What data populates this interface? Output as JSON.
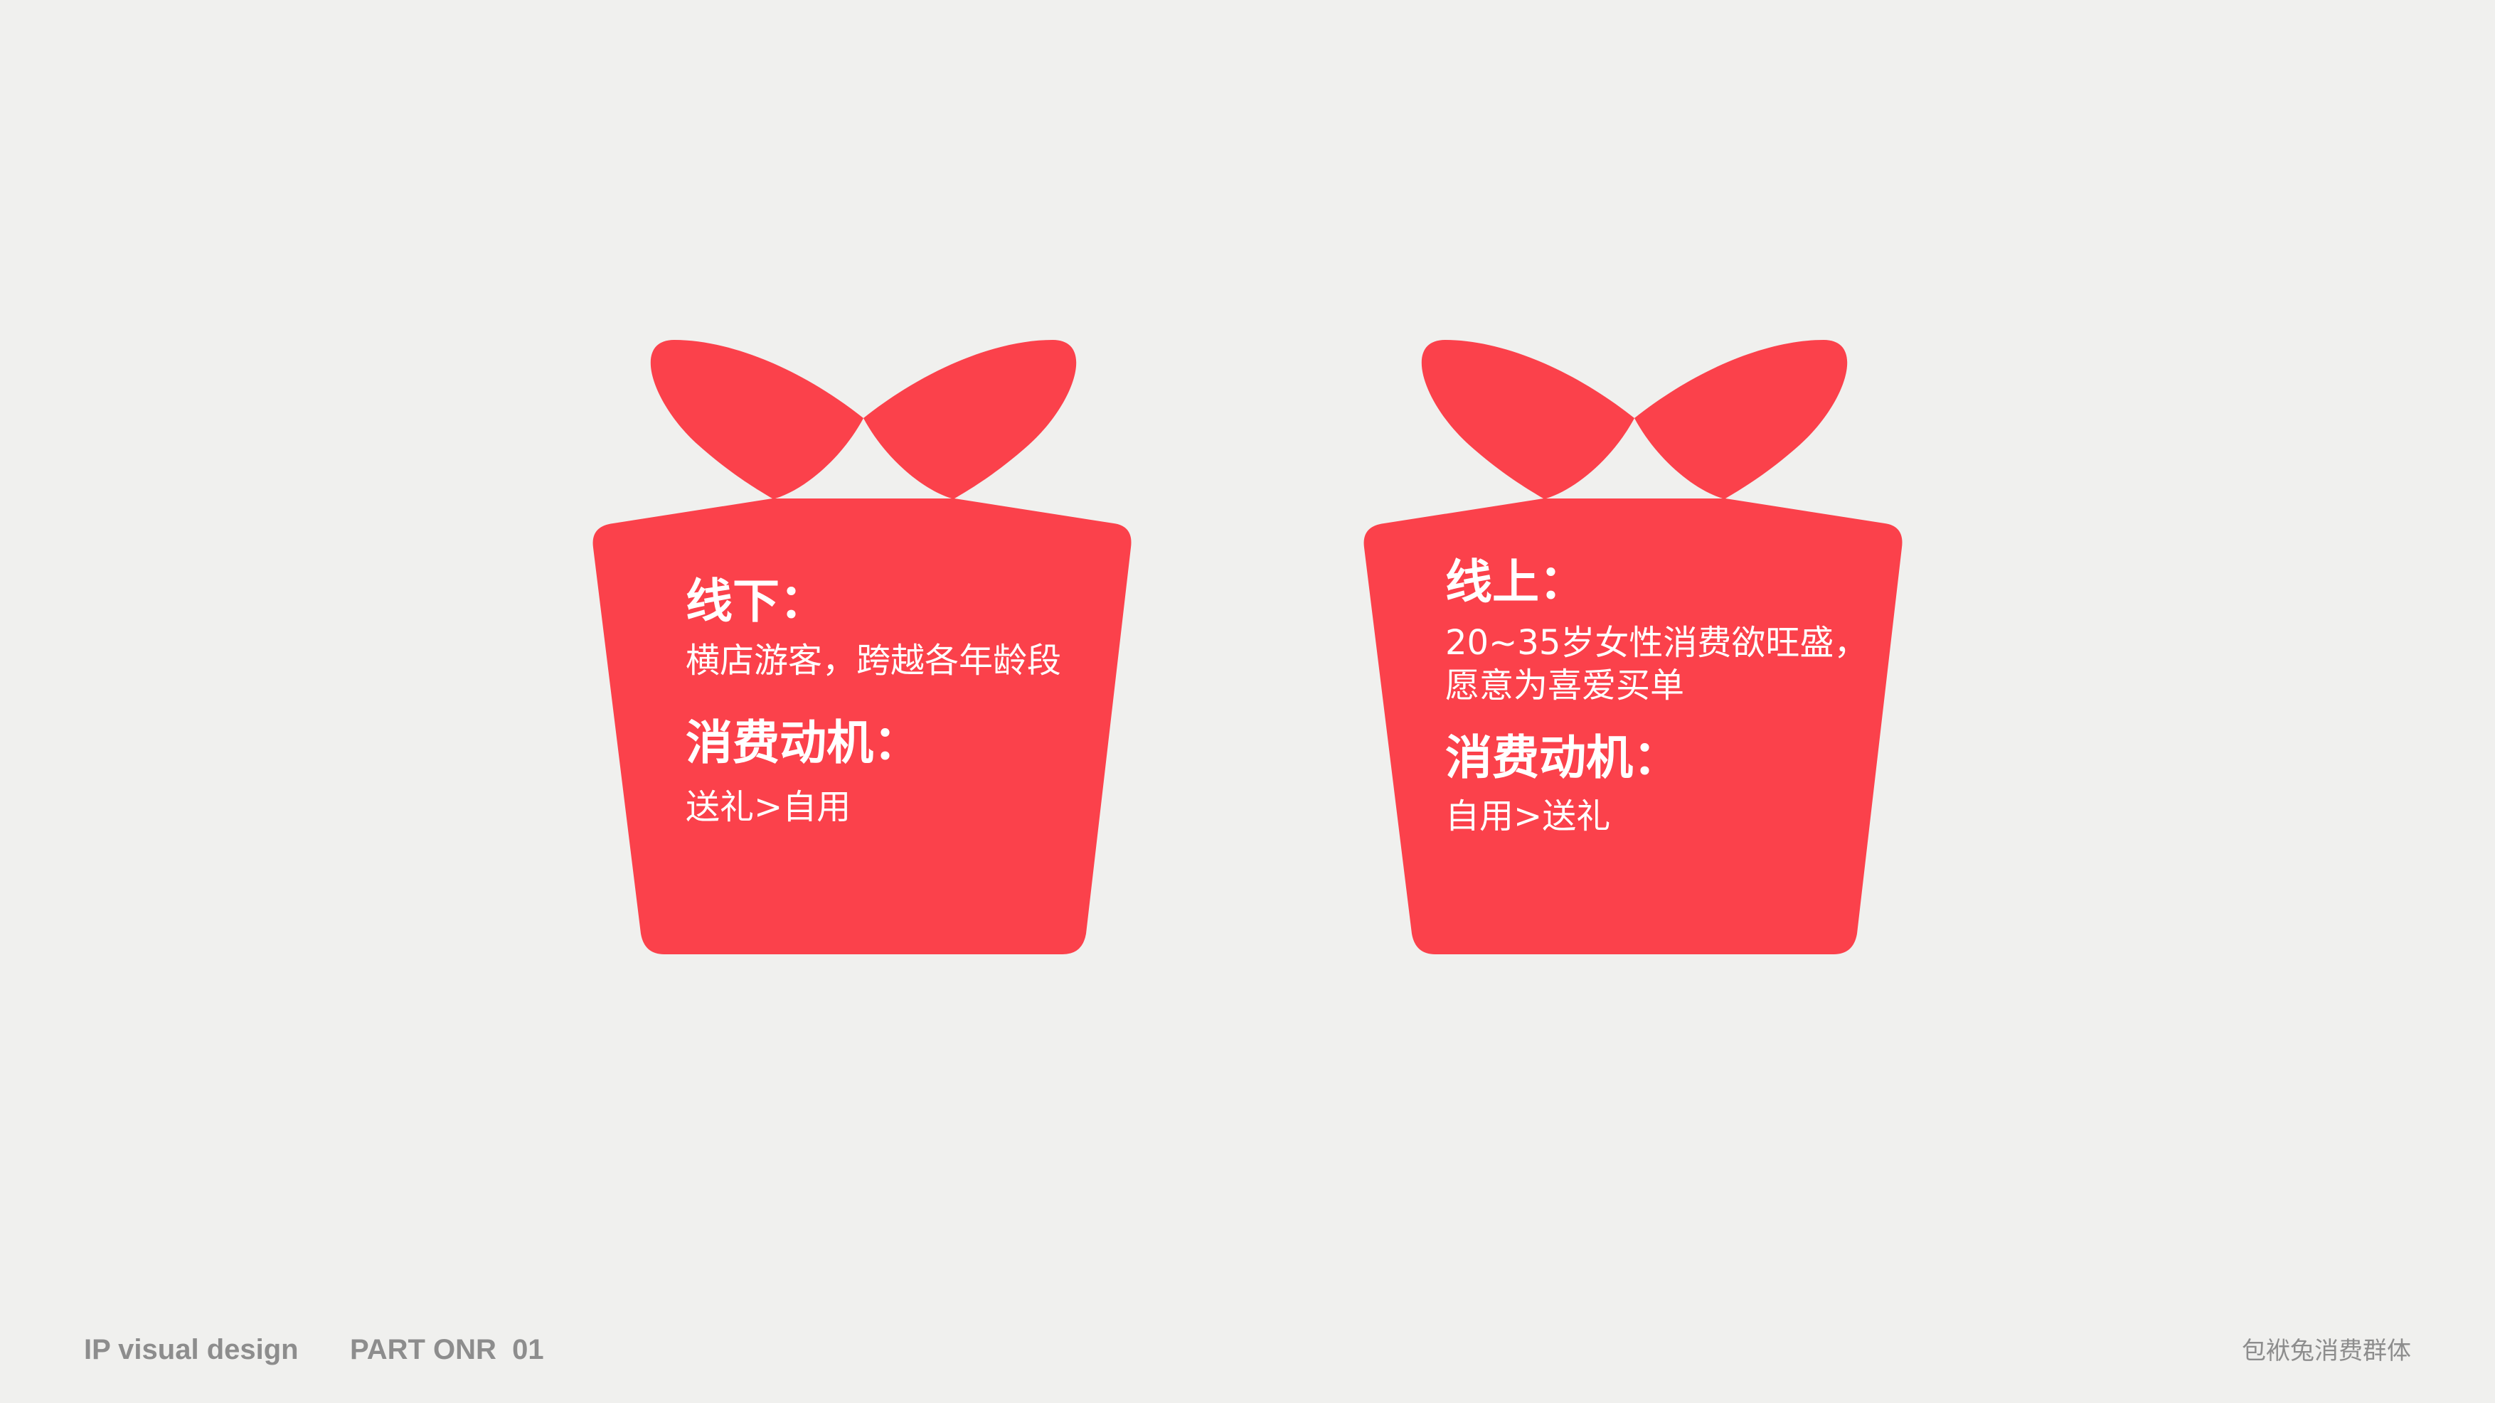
{
  "colors": {
    "background": "#f0f0ee",
    "gift": "#fb414b",
    "text": "#ffffff",
    "footer": "#8d8d8d"
  },
  "cards": [
    {
      "icon": "gift-icon",
      "title": "线下：",
      "body_lines": [
        "横店游客，跨越各年龄段"
      ],
      "motive_title": "消费动机：",
      "motive_text": "送礼>自用"
    },
    {
      "icon": "gift-icon",
      "title": "线上：",
      "body_lines": [
        "20~35岁女性消费欲旺盛，",
        "愿意为喜爱买单"
      ],
      "motive_title": "消费动机：",
      "motive_text": "自用>送礼"
    }
  ],
  "footer": {
    "left": "IP visual design",
    "part": "PART ONR  01",
    "right": "包袱兔消费群体"
  }
}
